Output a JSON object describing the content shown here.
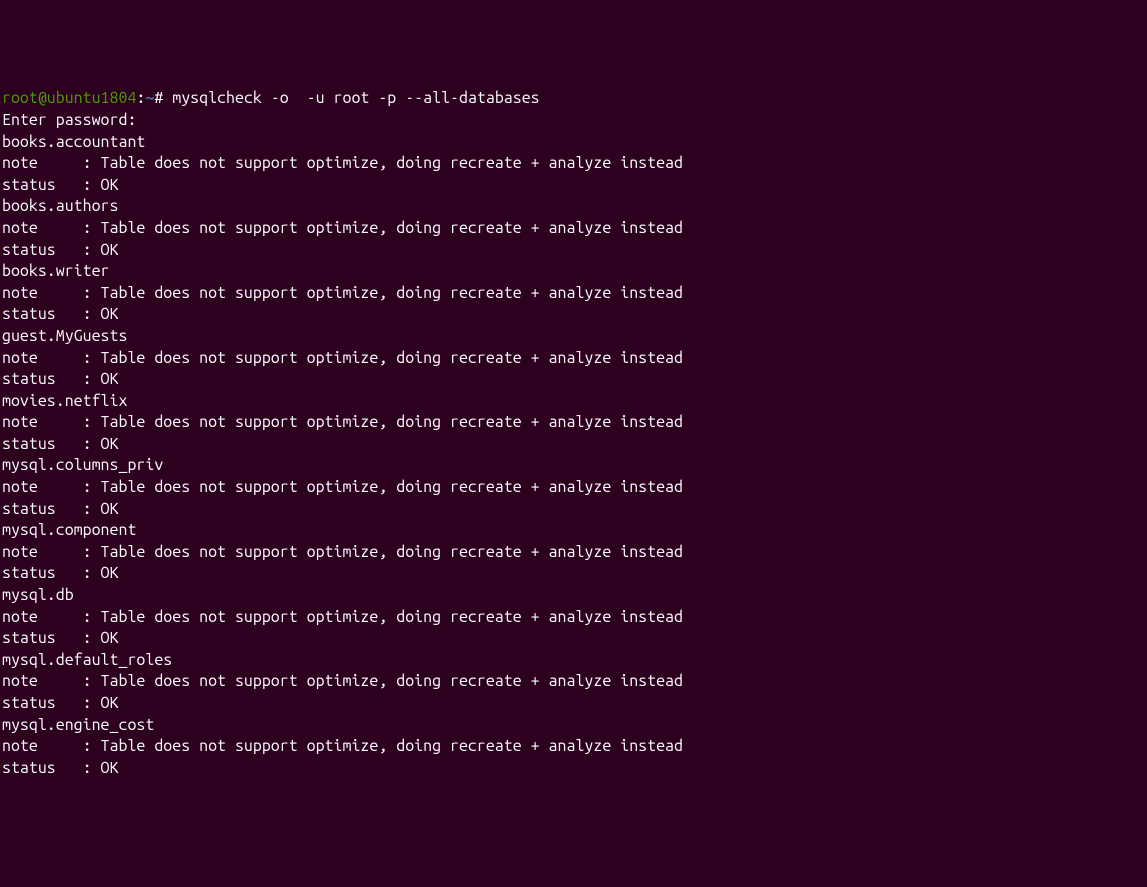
{
  "prompt": {
    "user_host": "root@ubuntu1804",
    "colon": ":",
    "path": "~",
    "hash": "# ",
    "command": "mysqlcheck -o  -u root -p --all-databases"
  },
  "password_prompt": "Enter password:",
  "note_text": "note     : Table does not support optimize, doing recreate + analyze instead",
  "status_text": "status   : OK",
  "tables": [
    "books.accountant",
    "books.authors",
    "books.writer",
    "guest.MyGuests",
    "movies.netflix",
    "mysql.columns_priv",
    "mysql.component",
    "mysql.db",
    "mysql.default_roles",
    "mysql.engine_cost"
  ]
}
